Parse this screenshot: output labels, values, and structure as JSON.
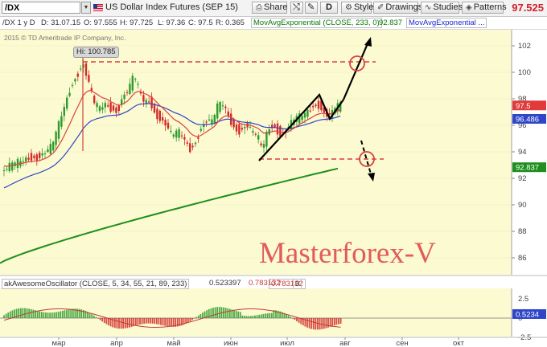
{
  "toolbar": {
    "symbol": "/DX",
    "instrument_name": "US Dollar Index Futures (SEP 15)",
    "share_label": "Share",
    "period_label": "D",
    "style_label": "Style",
    "drawings_label": "Drawings",
    "studies_label": "Studies",
    "patterns_label": "Patterns",
    "last_price": "97.525"
  },
  "infobar": {
    "symbol_period": "/DX 1 y D",
    "date": "D: 31.07.15",
    "open": "O: 97.555",
    "high": "H: 97.725",
    "low": "L: 97.36",
    "close": "C: 97.5",
    "range": "R: 0.365",
    "indicator1": "MovAvgExponential (CLOSE, 233, 0)",
    "indicator1_value": "92.837",
    "indicator2": "MovAvgExponential ..."
  },
  "chart": {
    "copyright": "2015 © TD Ameritrade IP Company, Inc.",
    "hi_label": "Hi: 100.785",
    "watermark": "Masterforex-V",
    "y_ticks": [
      "102",
      "100",
      "98",
      "96",
      "94",
      "92",
      "90",
      "88",
      "86"
    ],
    "price_tags": [
      {
        "value": "97.5",
        "color": "#e03a3a"
      },
      {
        "value": "96.486",
        "color": "#2f46c8"
      },
      {
        "value": "92.837",
        "color": "#1f8f1f"
      }
    ],
    "months": [
      "мар",
      "апр",
      "май",
      "июн",
      "июл",
      "авг",
      "сен",
      "окт"
    ],
    "colors": {
      "background": "#fbfad0",
      "candle_up": "#2e9a2e",
      "candle_down": "#d22a2a",
      "ema_fast": "#e04040",
      "ema_mid": "#2f46c8",
      "ema_slow": "#1f8f1f",
      "level_line": "#d84040"
    }
  },
  "oscillator": {
    "name": "akAwesomeOscillator (CLOSE, 5, 34, 55, 21, 89, 233)",
    "value1": "0.523397",
    "value2": "0.783132",
    "value3": "0.783132",
    "value4": "0",
    "y_ticks": [
      "2.5",
      "0",
      "-2.5"
    ],
    "price_tag": "0.5234"
  }
}
